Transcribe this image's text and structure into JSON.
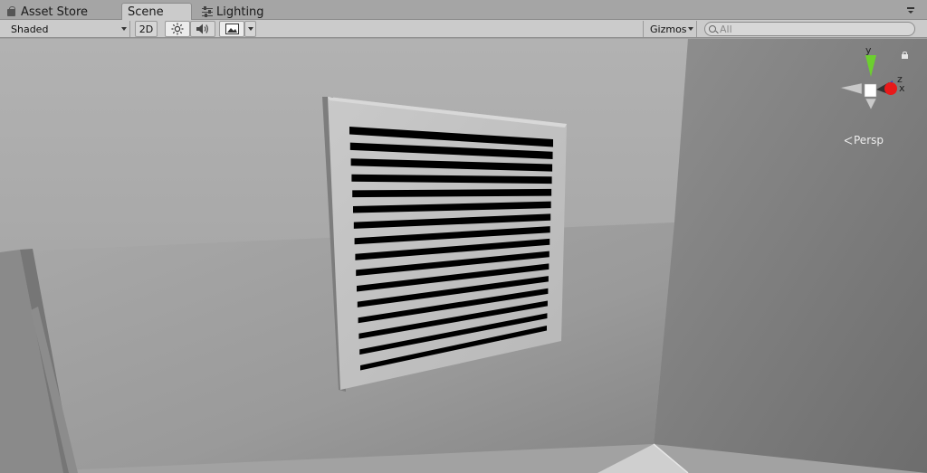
{
  "tabs": [
    {
      "label": "Asset Store",
      "icon": "bag-icon",
      "active": false
    },
    {
      "label": "Scene",
      "icon": "",
      "active": true
    },
    {
      "label": "Lighting",
      "icon": "sliders-icon",
      "active": false
    }
  ],
  "toolbar": {
    "draw_mode": "Shaded",
    "mode_2d": "2D",
    "lighting_toggle_icon": "sun-icon",
    "audio_toggle_icon": "speaker-icon",
    "effects_toggle_icon": "image-icon",
    "gizmos_label": "Gizmos",
    "search_placeholder": "All"
  },
  "scene_gizmo": {
    "axis_y": "y",
    "axis_z": "z",
    "axis_x": "x",
    "projection_label": "Persp",
    "colors": {
      "y": "#6ccf2e",
      "x": "#e8191a",
      "z": "#2f3fd6",
      "neutral": "#c9c9c9"
    }
  },
  "vent_grille": {
    "slat_count": 16
  }
}
